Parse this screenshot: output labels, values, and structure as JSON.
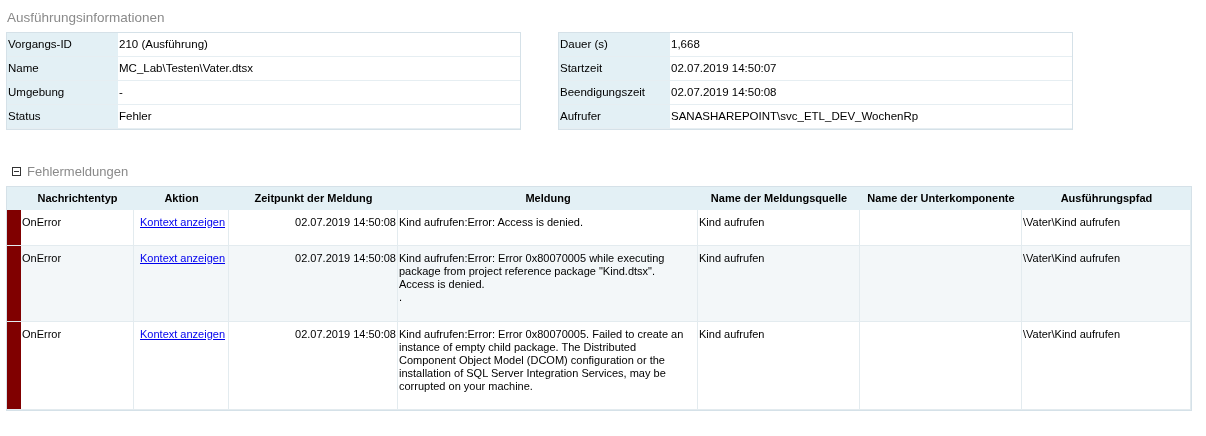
{
  "info_section": {
    "title": "Ausführungsinformationen"
  },
  "info_left": [
    {
      "label": "Vorgangs-ID",
      "value": "210 (Ausführung)"
    },
    {
      "label": "Name",
      "value": "MC_Lab\\Testen\\Vater.dtsx"
    },
    {
      "label": "Umgebung",
      "value": "-"
    },
    {
      "label": "Status",
      "value": "Fehler"
    }
  ],
  "info_right": [
    {
      "label": "Dauer (s)",
      "value": "1,668"
    },
    {
      "label": "Startzeit",
      "value": "02.07.2019 14:50:07"
    },
    {
      "label": "Beendigungszeit",
      "value": "02.07.2019 14:50:08"
    },
    {
      "label": "Aufrufer",
      "value": "SANASHAREPOINT\\svc_ETL_DEV_WochenRp"
    }
  ],
  "error_section": {
    "title": "Fehlermeldungen",
    "expanded": true
  },
  "table": {
    "columns": [
      "Nachrichtentyp",
      "Aktion",
      "Zeitpunkt der Meldung",
      "Meldung",
      "Name der Meldungsquelle",
      "Name der Unterkomponente",
      "Ausführungspfad"
    ],
    "rows": [
      {
        "color": "#800000",
        "type": "OnError",
        "action": "Kontext anzeigen",
        "time": "02.07.2019 14:50:08",
        "message": [
          "Kind aufrufen:Error: Access is denied."
        ],
        "source": "Kind aufrufen",
        "path": "\\Vater\\Kind aufrufen"
      },
      {
        "color": "#800000",
        "type": "OnError",
        "action": "Kontext anzeigen",
        "time": "02.07.2019 14:50:08",
        "message": [
          "Kind aufrufen:Error: Error 0x80070005 while executing",
          "package from project reference package \"Kind.dtsx\".",
          "Access is denied.",
          "."
        ],
        "source": "Kind aufrufen",
        "path": "\\Vater\\Kind aufrufen"
      },
      {
        "color": "#800000",
        "type": "OnError",
        "action": "Kontext anzeigen",
        "time": "02.07.2019 14:50:08",
        "message": [
          "Kind aufrufen:Error: Error 0x80070005. Failed to create an",
          "instance of empty child package. The Distributed",
          "Component Object Model (DCOM) configuration or the",
          "installation of SQL Server Integration Services, may be",
          "corrupted on your machine."
        ],
        "source": "Kind aufrufen",
        "path": "\\Vater\\Kind aufrufen"
      }
    ]
  }
}
